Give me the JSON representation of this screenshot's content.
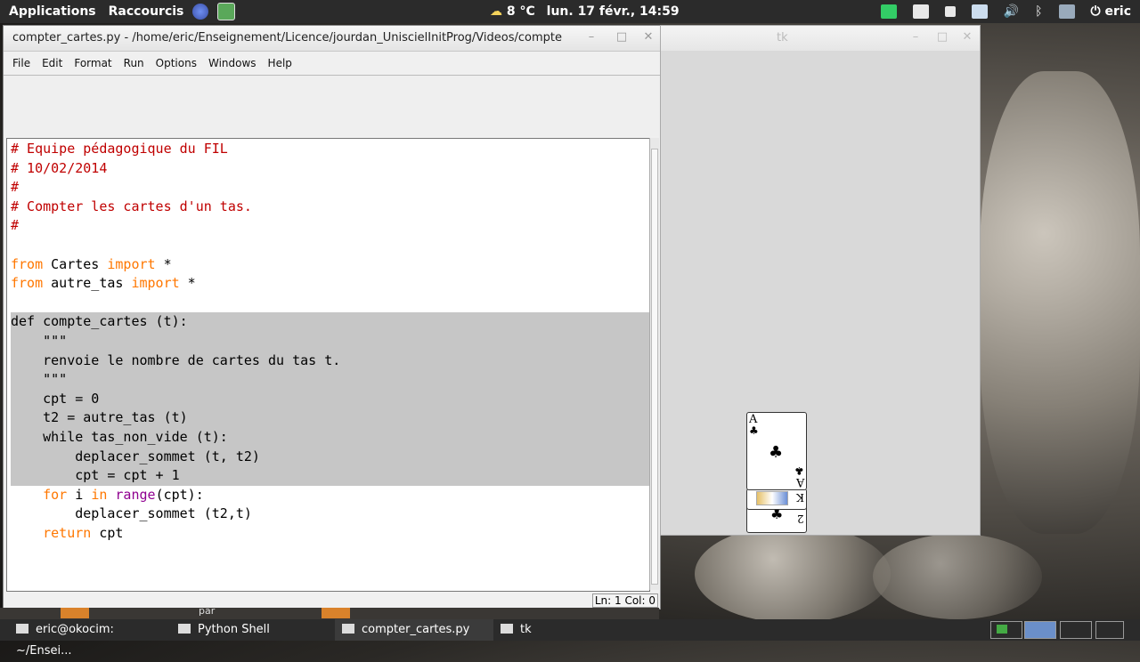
{
  "top_panel": {
    "applications": "Applications",
    "shortcuts": "Raccourcis",
    "weather": "8 °C",
    "datetime": "lun. 17 févr., 14:59",
    "user": "eric"
  },
  "editor": {
    "title": "compter_cartes.py - /home/eric/Enseignement/Licence/jourdan_UniscielInitProg/Videos/compte",
    "menu": [
      "File",
      "Edit",
      "Format",
      "Run",
      "Options",
      "Windows",
      "Help"
    ],
    "status": "Ln: 1 Col: 0",
    "code": {
      "l1": "# Equipe pédagogique du FIL",
      "l2": "# 10/02/2014",
      "l3": "#",
      "l4": "# Compter les cartes d'un tas.",
      "l5": "#",
      "l7_kw1": "from",
      "l7_mid": " Cartes ",
      "l7_kw2": "import",
      "l7_end": " *",
      "l8_kw1": "from",
      "l8_mid": " autre_tas ",
      "l8_kw2": "import",
      "l8_end": " *",
      "l10": "def compte_cartes (t):",
      "l11": "    \"\"\"",
      "l12": "    renvoie le nombre de cartes du tas t.",
      "l13": "    \"\"\"",
      "l14": "    cpt = 0",
      "l15": "    t2 = autre_tas (t)",
      "l16": "    while tas_non_vide (t):",
      "l17": "        deplacer_sommet (t, t2)",
      "l18": "        cpt = cpt + 1",
      "l19_kw1": "    for",
      "l19_mid": " i ",
      "l19_kw2": "in",
      "l19_sp": " ",
      "l19_bi": "range",
      "l19_end": "(cpt):",
      "l20": "        deplacer_sommet (t2,t)",
      "l21_kw": "    return",
      "l21_end": " cpt"
    }
  },
  "tk_window": {
    "title": "tk",
    "card_rank": "A",
    "card_suit": "♣",
    "card_rank_flipped": "A",
    "card2_rank": "K",
    "card3_rank": "2"
  },
  "taskbar": {
    "partial_label": "par",
    "items": [
      "eric@okocim: ~/Ensei...",
      "Python Shell",
      "compter_cartes.py",
      "tk"
    ]
  },
  "colors": {
    "comment": "#c00000",
    "keyword": "#ff7700",
    "builtin": "#900090",
    "selection": "#c6c6c6"
  }
}
